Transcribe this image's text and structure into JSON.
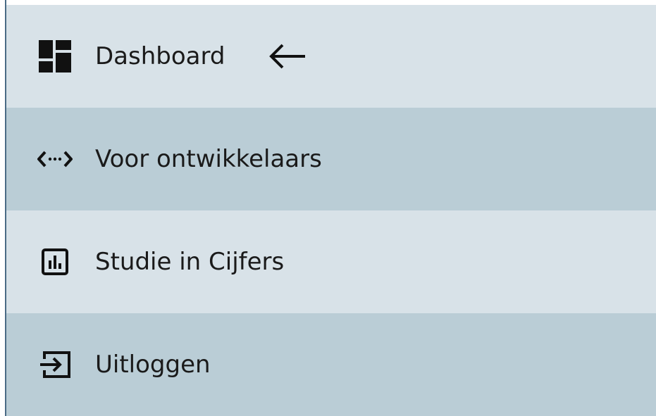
{
  "menu": {
    "items": [
      {
        "label": "Dashboard",
        "icon": "dashboard-icon",
        "active": true
      },
      {
        "label": "Voor ontwikkelaars",
        "icon": "code-icon",
        "active": false
      },
      {
        "label": "Studie in Cijfers",
        "icon": "bar-chart-icon",
        "active": false
      },
      {
        "label": "Uitloggen",
        "icon": "logout-icon",
        "active": false
      }
    ]
  },
  "colors": {
    "item_light": "#d8e2e8",
    "item_dark": "#bacdd6",
    "text": "#1a1a1a",
    "border": "#4a6b85"
  }
}
